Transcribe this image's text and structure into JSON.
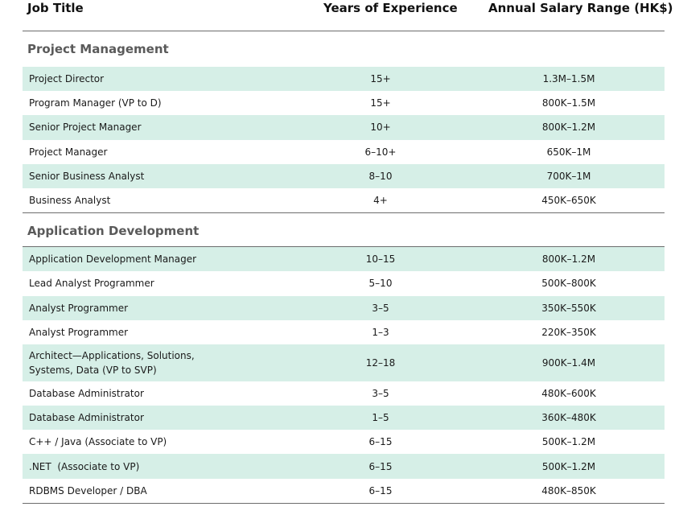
{
  "header": {
    "job_title": "Job Title",
    "years": "Years of Experience",
    "salary": "Annual Salary Range (HK$)"
  },
  "sections": [
    {
      "title": "Project Management",
      "rows": [
        {
          "job": "Project Director",
          "years": "15+",
          "salary": "1.3M–1.5M"
        },
        {
          "job": "Program Manager (VP to D)",
          "years": "15+",
          "salary": "800K–1.5M"
        },
        {
          "job": "Senior Project Manager",
          "years": "10+",
          "salary": "800K–1.2M"
        },
        {
          "job": "Project Manager",
          "years": "6–10+",
          "salary": "650K–1M"
        },
        {
          "job": "Senior Business Analyst",
          "years": "8–10",
          "salary": "700K–1M"
        },
        {
          "job": "Business Analyst",
          "years": "4+",
          "salary": "450K–650K"
        }
      ]
    },
    {
      "title": "Application Development",
      "rows": [
        {
          "job": "Application Development Manager",
          "years": "10–15",
          "salary": "800K–1.2M"
        },
        {
          "job": "Lead Analyst Programmer",
          "years": "5–10",
          "salary": "500K–800K"
        },
        {
          "job": "Analyst Programmer",
          "years": "3–5",
          "salary": "350K–550K"
        },
        {
          "job": "Analyst Programmer",
          "years": "1–3",
          "salary": "220K–350K"
        },
        {
          "job": "Architect—Applications, Solutions, Systems, Data (VP to SVP)",
          "years": "12–18",
          "salary": "900K–1.4M"
        },
        {
          "job": "Database Administrator",
          "years": "3–5",
          "salary": "480K–600K"
        },
        {
          "job": "Database Administrator",
          "years": "1–5",
          "salary": "360K–480K"
        },
        {
          "job": "C++ / Java (Associate to VP)",
          "years": "6–15",
          "salary": "500K–1.2M"
        },
        {
          "job": ".NET  (Associate to VP)",
          "years": "6–15",
          "salary": "500K–1.2M"
        },
        {
          "job": "RDBMS Developer / DBA",
          "years": "6–15",
          "salary": "480K–850K"
        }
      ]
    }
  ],
  "colors": {
    "row_shade": "#d6efe7",
    "rule": "#6d6d6d",
    "section_title": "#5a5a5a"
  }
}
